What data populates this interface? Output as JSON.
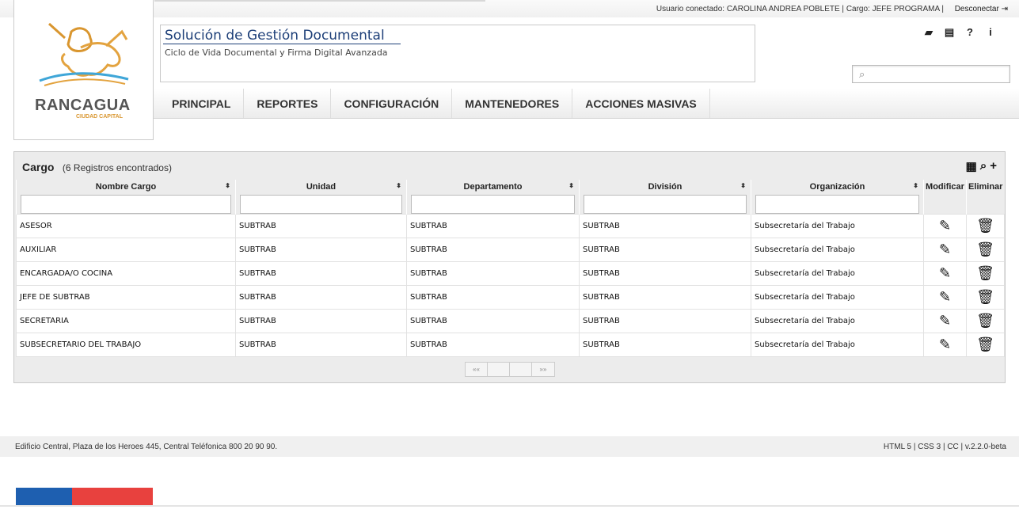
{
  "header": {
    "user_info": "Usuario conectado: CAROLINA ANDREA POBLETE | Cargo: JEFE PROGRAMA |",
    "logout_label": "Desconectar",
    "logo_city": "RANCAGUA",
    "logo_sub": "CIUDAD CAPITAL",
    "app_title": "Solución de Gestión Documental",
    "app_subtitle": "Ciclo de Vida Documental y Firma Digital Avanzada",
    "search_placeholder": "",
    "icons": [
      "book-icon",
      "news-icon",
      "help-icon",
      "info-icon"
    ]
  },
  "menu": {
    "items": [
      {
        "label": "PRINCIPAL"
      },
      {
        "label": "REPORTES"
      },
      {
        "label": "CONFIGURACIÓN"
      },
      {
        "label": "MANTENEDORES"
      },
      {
        "label": "ACCIONES MASIVAS"
      }
    ]
  },
  "panel": {
    "title": "Cargo",
    "count": "(6 Registros encontrados)",
    "columns": [
      "Nombre Cargo",
      "Unidad",
      "Departamento",
      "División",
      "Organización",
      "Modificar",
      "Eliminar"
    ],
    "rows": [
      [
        "ASESOR",
        "SUBTRAB",
        "SUBTRAB",
        "SUBTRAB",
        "Subsecretaría del Trabajo"
      ],
      [
        "AUXILIAR",
        "SUBTRAB",
        "SUBTRAB",
        "SUBTRAB",
        "Subsecretaría del Trabajo"
      ],
      [
        "ENCARGADA/O COCINA",
        "SUBTRAB",
        "SUBTRAB",
        "SUBTRAB",
        "Subsecretaría del Trabajo"
      ],
      [
        "JEFE DE SUBTRAB",
        "SUBTRAB",
        "SUBTRAB",
        "SUBTRAB",
        "Subsecretaría del Trabajo"
      ],
      [
        "SECRETARIA",
        "SUBTRAB",
        "SUBTRAB",
        "SUBTRAB",
        "Subsecretaría del Trabajo"
      ],
      [
        "SUBSECRETARIO DEL TRABAJO",
        "SUBTRAB",
        "SUBTRAB",
        "SUBTRAB",
        "Subsecretaría del Trabajo"
      ]
    ],
    "pager": {
      "first": "««",
      "prev": "",
      "next": "",
      "last": "»»"
    }
  },
  "footer": {
    "address": "Edificio Central, Plaza de los Heroes 445, Central Teléfonica 800 20 90 90.",
    "version": "HTML 5 | CSS 3 | CC | v.2.2.0-beta"
  },
  "colors": {
    "title_blue": "#1d3f78",
    "flag_blue": "#1e5fb0",
    "flag_red": "#e8413e",
    "logo_orange": "#d9962f"
  }
}
